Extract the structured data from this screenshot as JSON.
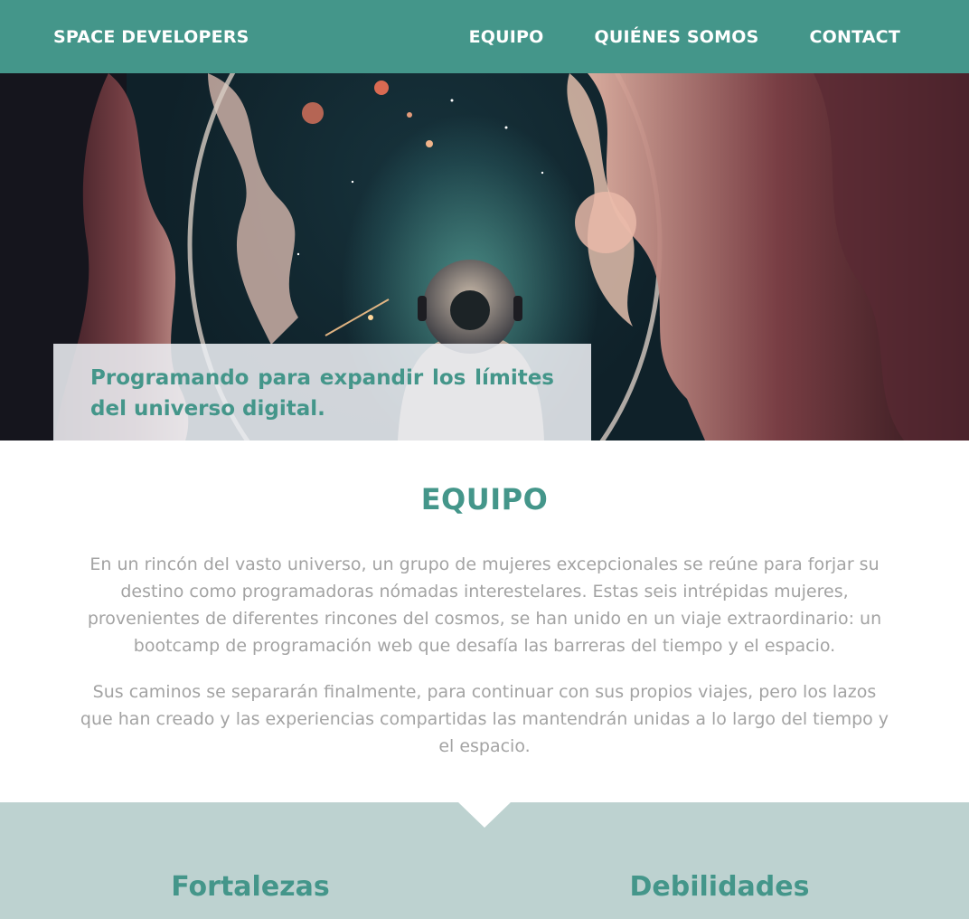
{
  "header": {
    "brand": "SPACE DEVELOPERS",
    "nav": [
      {
        "label": "EQUIPO"
      },
      {
        "label": "QUIÉNES SOMOS"
      },
      {
        "label": "CONTACT"
      }
    ]
  },
  "hero": {
    "caption": "Programando para expandir los límites del universo digital."
  },
  "equipo": {
    "title": "EQUIPO",
    "paragraphs": [
      "En un rincón del vasto universo, un grupo de mujeres excepcionales se reúne para forjar su destino como programadoras nómadas interestelares. Estas seis intrépidas mujeres, provenientes de diferentes rincones del cosmos, se han unido en un viaje extraordinario: un bootcamp de programación web que desafía las barreras del tiempo y el espacio.",
      "Sus caminos se separarán finalmente, para continuar con sus propios viajes, pero los lazos que han creado y las experiencias compartidas las mantendrán unidas a lo largo del tiempo y el espacio."
    ]
  },
  "cualidades": {
    "fortalezas_title": "Fortalezas",
    "debilidades_title": "Debilidades"
  },
  "colors": {
    "accent": "#44968a",
    "body_text": "#a3a3a3",
    "section_bg": "#bdd2d0"
  }
}
